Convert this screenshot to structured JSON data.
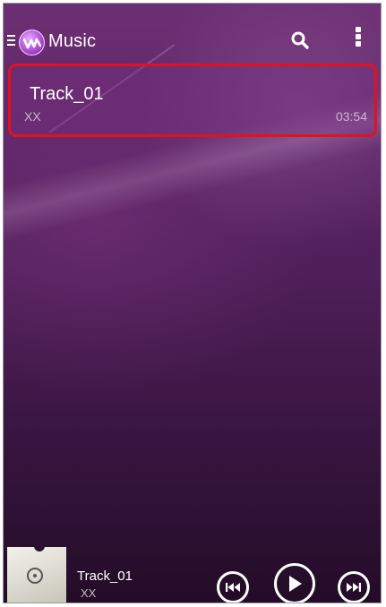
{
  "header": {
    "app_title": "Music",
    "menu_icon": "hamburger-menu-icon",
    "logo_icon": "walkman-logo-icon",
    "search_icon": "search-icon",
    "more_icon": "more-vertical-icon"
  },
  "tracks": [
    {
      "title": "Track_01",
      "artist": "XX",
      "duration": "03:54",
      "highlighted": true
    }
  ],
  "player": {
    "title": "Track_01",
    "artist": "XX",
    "prev_icon": "skip-previous-icon",
    "play_icon": "play-icon",
    "next_icon": "skip-next-icon"
  },
  "colors": {
    "background": "#4f1f59",
    "highlight_border": "#e4111b",
    "text_primary": "#ffffff",
    "text_secondary": "#cbb6cf"
  }
}
